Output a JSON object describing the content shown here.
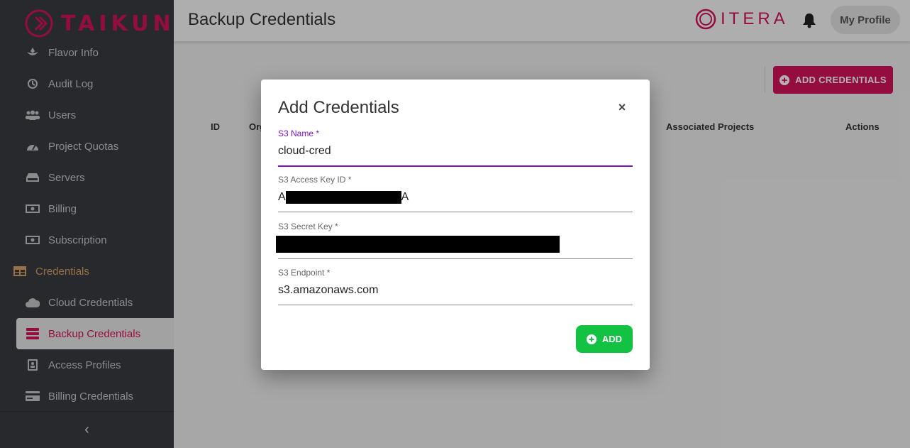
{
  "brand": {
    "name": "TAIKUN",
    "color": "#d4145a"
  },
  "sidebar": {
    "items": [
      {
        "label": "Flavor Info",
        "icon": "flavor-icon"
      },
      {
        "label": "Audit Log",
        "icon": "history-icon"
      },
      {
        "label": "Users",
        "icon": "users-icon"
      },
      {
        "label": "Project Quotas",
        "icon": "gauge-icon"
      },
      {
        "label": "Servers",
        "icon": "server-icon"
      },
      {
        "label": "Billing",
        "icon": "money-icon"
      },
      {
        "label": "Subscription",
        "icon": "money-icon"
      },
      {
        "label": "Credentials",
        "icon": "table-icon",
        "section": true
      },
      {
        "label": "Cloud Credentials",
        "icon": "cloud-icon"
      },
      {
        "label": "Backup Credentials",
        "icon": "database-icon",
        "active": true
      },
      {
        "label": "Access Profiles",
        "icon": "id-badge-icon"
      },
      {
        "label": "Billing Credentials",
        "icon": "credit-card-icon"
      }
    ],
    "collapse_label": "‹"
  },
  "header": {
    "title": "Backup Credentials",
    "org_logo": "ITERA",
    "profile_label": "My Profile"
  },
  "main": {
    "add_credentials_label": "ADD CREDENTIALS",
    "table_headers": {
      "id": "ID",
      "org": "Org",
      "associated_projects": "Associated Projects",
      "actions": "Actions"
    }
  },
  "dialog": {
    "title": "Add Credentials",
    "close_label": "×",
    "fields": {
      "s3_name": {
        "label": "S3 Name *",
        "value": "cloud-cred"
      },
      "s3_access_key_id": {
        "label": "S3 Access Key ID *",
        "value_prefix": "A",
        "value_suffix": "A"
      },
      "s3_secret_key": {
        "label": "S3 Secret Key *"
      },
      "s3_endpoint": {
        "label": "S3 Endpoint *",
        "value": "s3.amazonaws.com"
      }
    },
    "add_label": "ADD"
  },
  "colors": {
    "accent": "#d4145a",
    "focus": "#7a12c4",
    "success": "#13c243",
    "sidebar_bg": "#3a3c40"
  }
}
